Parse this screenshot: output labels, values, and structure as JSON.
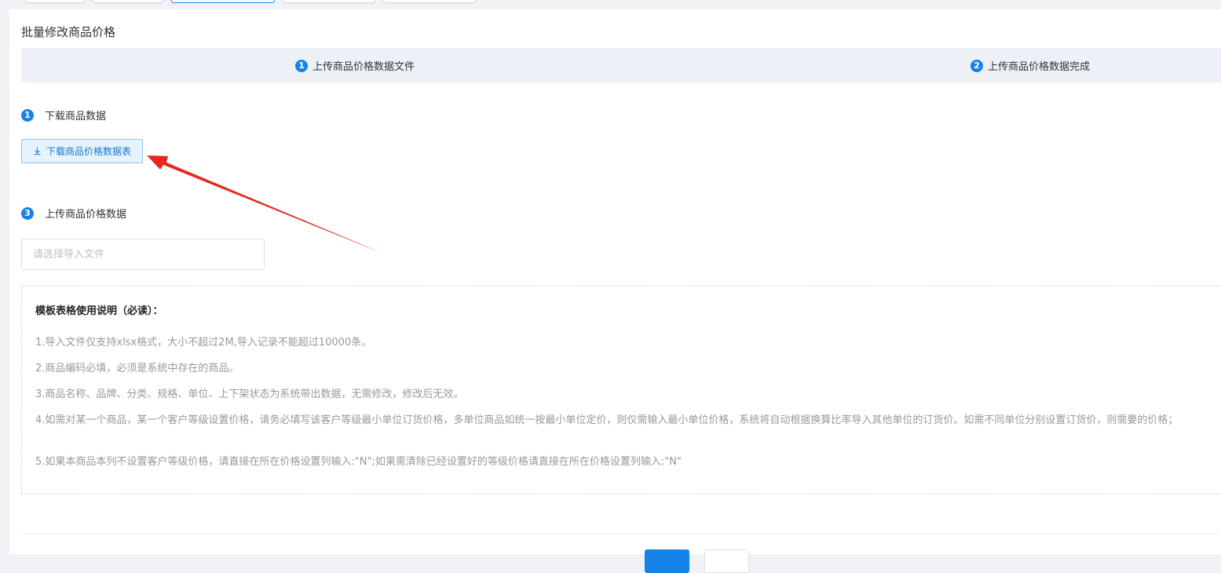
{
  "page": {
    "title": "批量修改商品价格"
  },
  "steps": [
    {
      "number": "1",
      "label": "上传商品价格数据文件"
    },
    {
      "number": "2",
      "label": "上传商品价格数据完成"
    }
  ],
  "download_section": {
    "number": "1",
    "title": "下载商品数据",
    "button_label": "下载商品价格数据表",
    "button_icon": "download-icon"
  },
  "upload_section": {
    "number": "3",
    "title": "上传商品价格数据",
    "placeholder": "请选择导入文件",
    "value": ""
  },
  "notes": {
    "title": "模板表格使用说明（必读）：",
    "items": [
      "1.导入文件仅支持xlsx格式，大小不超过2M,导入记录不能超过10000条。",
      "2.商品编码必填，必须是系统中存在的商品。",
      "3.商品名称、品牌、分类、规格、单位、上下架状态为系统带出数据，无需修改，修改后无效。",
      "4.如需对某一个商品，某一个客户等级设置价格，请务必填写该客户等级最小单位订货价格，多单位商品如统一按最小单位定价，则仅需输入最小单位价格，系统将自动根据换算比率导入其他单位的订货价。如需不同单位分别设置订货价，则需要的价格；",
      "5.如果本商品本列不设置客户等级价格，请直接在所在价格设置列输入:\"N\";如果需清除已经设置好的等级价格请直接在所在价格设置列输入:\"N\""
    ]
  },
  "colors": {
    "accent": "#1683e8",
    "annotation_arrow": "#e8281e"
  }
}
